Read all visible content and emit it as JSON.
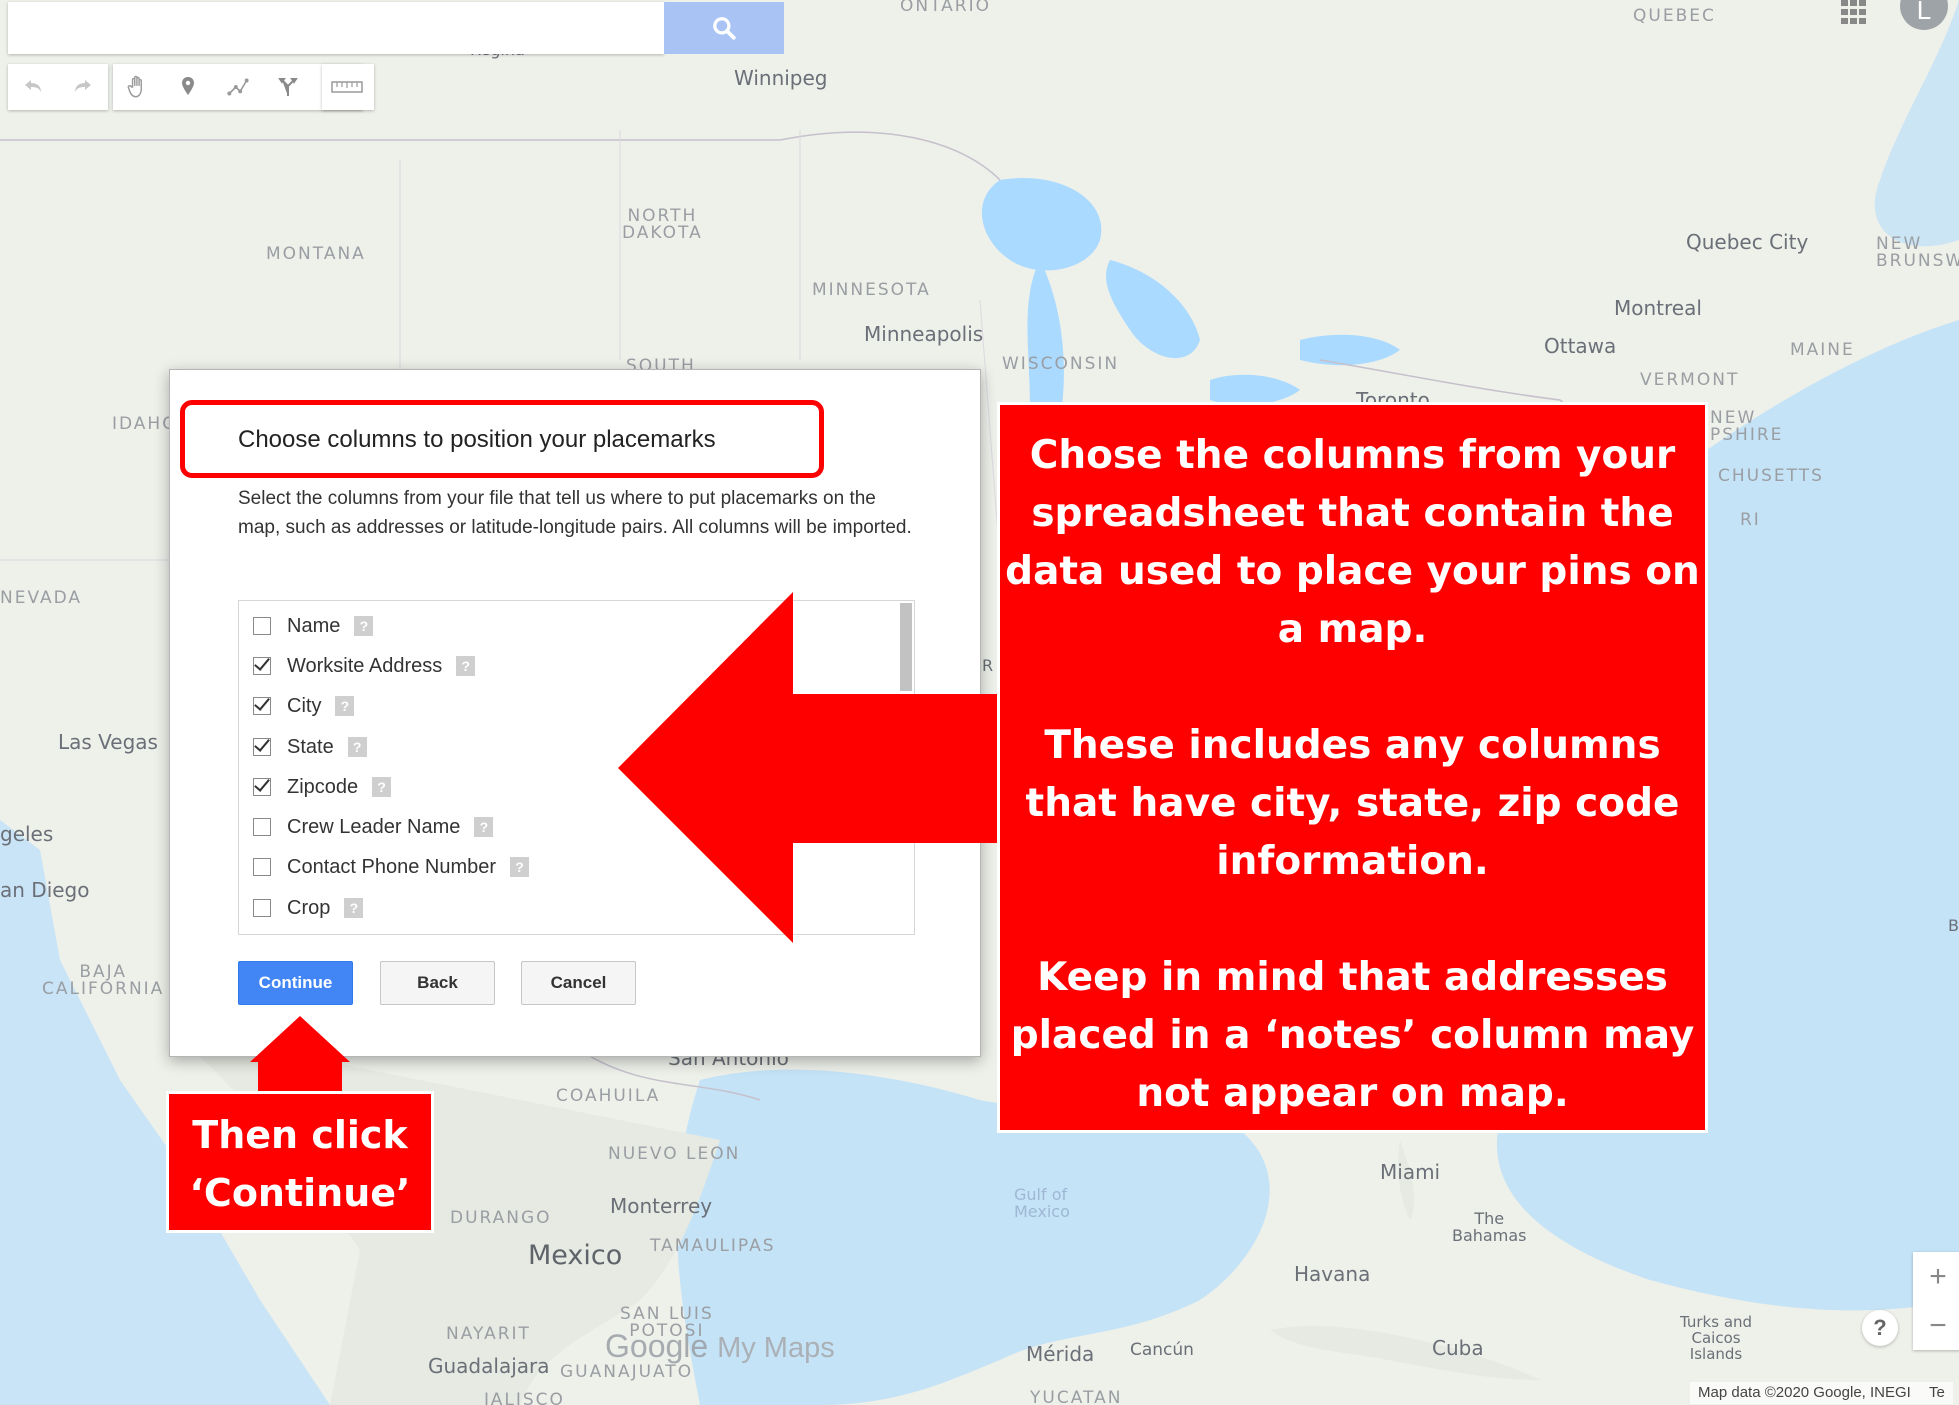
{
  "map": {
    "labels": {
      "ontario": "ONTARIO",
      "quebec": "QUEBEC",
      "winnipeg": "Winnipeg",
      "regina": "Regina",
      "north_dakota": "NORTH\nDAKOTA",
      "montana": "MONTANA",
      "minnesota": "MINNESOTA",
      "minneapolis": "Minneapolis",
      "wisconsin": "WISCONSIN",
      "south": "SOUTH",
      "quebec_city": "Quebec City",
      "new_brunswick": "NEW\nBRUNSW",
      "montreal": "Montreal",
      "ottawa": "Ottawa",
      "maine": "MAINE",
      "vermont": "VERMONT",
      "toronto": "Toronto",
      "new_hampshire": "NEW\nPSHIRE",
      "massachusetts": "CHUSETTS",
      "ri": "RI",
      "idaho": "IDAHO",
      "nevada": "NEVADA",
      "las_vegas": "Las Vegas",
      "los_angeles": "geles",
      "san_diego": "an Diego",
      "baja_california": "BAJA\nCALIFORNIA",
      "coahuila": "COAHUILA",
      "nuevo_leon": "NUEVO LEON",
      "san_antonio": "San Antonio",
      "durango": "DURANGO",
      "monterrey": "Monterrey",
      "mexico": "Mexico",
      "tamaulipas": "TAMAULIPAS",
      "gulf_of_mexico": "Gulf of\nMexico",
      "miami": "Miami",
      "the_bahamas": "The\nBahamas",
      "havana": "Havana",
      "nayarit": "NAYARIT",
      "san_luis_potosi": "SAN LUIS\nPOTOSI",
      "guadalajara": "Guadalajara",
      "guanajuato": "GUANAJUATO",
      "jalisco": "JALISCO",
      "merida": "Mérida",
      "cancun": "Cancún",
      "yucatan": "YUCATAN",
      "cuba": "Cuba",
      "turks_caicos": "Turks and\nCaicos\nIslands",
      "b_edge": "B",
      "r_edge": "R"
    },
    "logo_text": "Google",
    "logo_suffix": "My Maps",
    "attribution": "Map data ©2020 Google, INEGI",
    "attribution_tail": "Te",
    "avatar_letter": "L",
    "zoom_in": "+",
    "zoom_out": "−",
    "help": "?"
  },
  "dialog": {
    "title": "Choose columns to position your placemarks",
    "description": "Select the columns from your file that tell us where to put placemarks on the map, such as addresses or latitude-longitude pairs. All columns will be imported.",
    "columns": [
      {
        "label": "Name",
        "checked": false
      },
      {
        "label": "Worksite Address",
        "checked": true
      },
      {
        "label": "City",
        "checked": true
      },
      {
        "label": "State",
        "checked": true
      },
      {
        "label": "Zipcode",
        "checked": true
      },
      {
        "label": "Crew Leader Name",
        "checked": false
      },
      {
        "label": "Contact Phone Number",
        "checked": false
      },
      {
        "label": "Crop",
        "checked": false
      }
    ],
    "help_glyph": "?",
    "continue_label": "Continue",
    "back_label": "Back",
    "cancel_label": "Cancel"
  },
  "annotations": {
    "main_callout": [
      "Chose the columns from your spreadsheet that contain the data used to place your pins on a map.",
      "These includes any columns that have city, state, zip code information.",
      "Keep in mind that addresses placed in a ‘notes’ column may not appear on map."
    ],
    "continue_callout": "Then click ‘Continue’",
    "highlight_color": "#ff0000"
  },
  "colors": {
    "accent": "#4285f4",
    "search_button": "#a9c3f5",
    "callout": "#ff0000"
  }
}
